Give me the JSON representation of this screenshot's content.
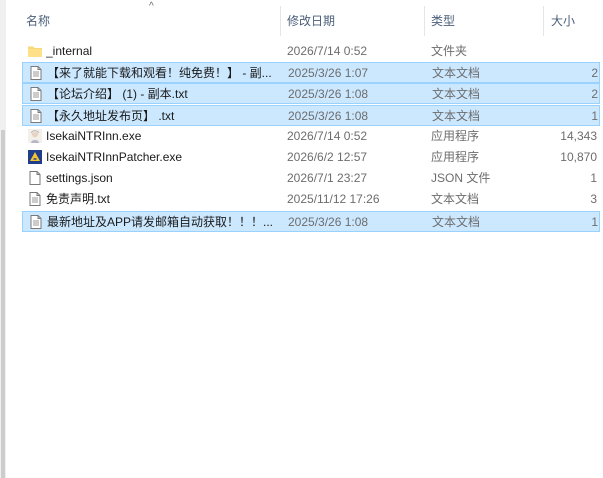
{
  "header": {
    "name": "名称",
    "date": "修改日期",
    "type": "类型",
    "size": "大小",
    "sort_indicator": "^"
  },
  "files": [
    {
      "name": "_internal",
      "date": "2026/7/14 0:52",
      "type": "文件夹",
      "size": "",
      "icon": "folder-icon",
      "selected": false
    },
    {
      "name": "【来了就能下载和观看！纯免费！】 - 副...",
      "date": "2025/3/26 1:07",
      "type": "文本文档",
      "size": "2",
      "icon": "text-file-icon",
      "selected": true
    },
    {
      "name": "【论坛介绍】 (1) - 副本.txt",
      "date": "2025/3/26 1:08",
      "type": "文本文档",
      "size": "2",
      "icon": "text-file-icon",
      "selected": true
    },
    {
      "name": "【永久地址发布页】 .txt",
      "date": "2025/3/26 1:08",
      "type": "文本文档",
      "size": "1",
      "icon": "text-file-icon",
      "selected": true
    },
    {
      "name": "IsekaiNTRInn.exe",
      "date": "2026/7/14 0:52",
      "type": "应用程序",
      "size": "14,343",
      "icon": "app-character-icon",
      "selected": false
    },
    {
      "name": "IsekaiNTRInnPatcher.exe",
      "date": "2026/6/2 12:57",
      "type": "应用程序",
      "size": "10,870",
      "icon": "patcher-app-icon",
      "selected": false
    },
    {
      "name": "settings.json",
      "date": "2026/7/1 23:27",
      "type": "JSON 文件",
      "size": "1",
      "icon": "json-file-icon",
      "selected": false
    },
    {
      "name": "免责声明.txt",
      "date": "2025/11/12 17:26",
      "type": "文本文档",
      "size": "3",
      "icon": "text-file-icon",
      "selected": false
    },
    {
      "name": "最新地址及APP请发邮箱自动获取！！！...",
      "date": "2025/3/26 1:08",
      "type": "文本文档",
      "size": "1",
      "icon": "text-file-icon",
      "selected": true
    }
  ]
}
